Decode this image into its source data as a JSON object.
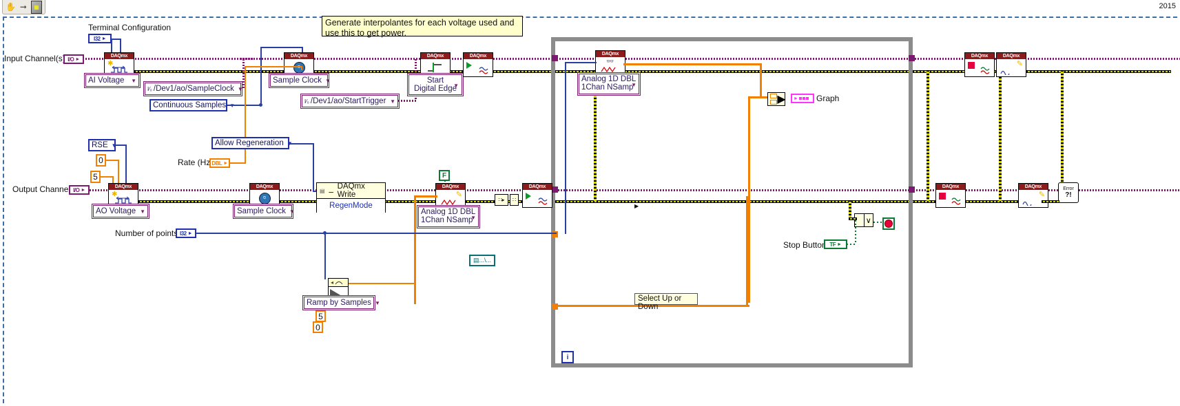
{
  "window": {
    "title_year": "2015",
    "toolbar_icons": [
      "hand-tool-icon",
      "arrow-right-icon",
      "connector-pane-icon"
    ]
  },
  "comments": {
    "interpolantes": "Generate interpolantes for each voltage used and use this to get power.",
    "select_up_down": "Select Up or Down"
  },
  "labels": {
    "terminal_configuration": "Terminal Configuration",
    "input_channels": "Input Channel(s)",
    "output_channel": "Output Channel",
    "rate_hz": "Rate (Hz)",
    "number_of_points": "Number of points",
    "stop_button": "Stop Button",
    "graph": "Graph"
  },
  "terminals": {
    "terminal_config_type": "I32",
    "input_channels_type": "I/O",
    "output_channel_type": "I/O",
    "rate_type": "DBL",
    "number_of_points_type": "I32",
    "stop_button_type": "TF"
  },
  "combos": {
    "ai_voltage": "AI Voltage",
    "ao_voltage": "AO Voltage",
    "sample_clock_ai": "Sample Clock",
    "sample_clock_ao": "Sample Clock",
    "source_sampleclock": "/Dev1/ao/SampleClock",
    "source_starttrigger": "/Dev1/ao/StartTrigger",
    "continuous_samples": "Continuous Samples",
    "allow_regeneration": "Allow Regeneration",
    "start_digital_edge": "Start\nDigital Edge",
    "start_digital_edge_l1": "Start",
    "start_digital_edge_l2": "Digital Edge",
    "rse": "RSE",
    "analog_1d_dbl_read_l1": "Analog 1D DBL",
    "analog_1d_dbl_read_l2": "1Chan NSamp",
    "analog_1d_dbl_write_l1": "Analog 1D DBL",
    "analog_1d_dbl_write_l2": "1Chan NSamp",
    "ramp_by_samples": "Ramp by Samples"
  },
  "vis": {
    "daqmx_write_title": "DAQmx Write",
    "daqmx_write_mode": "RegenMode",
    "error_handler": "Error ?!"
  },
  "constants": {
    "rse_min": "0",
    "rse_max": "5",
    "ramp_start": "5",
    "ramp_end": "0",
    "loop_index": "i",
    "false_const": "F"
  },
  "nodes": {
    "daqmx_create_ai": "DAQmx",
    "daqmx_timing_ai": "DAQmx",
    "daqmx_trigger": "DAQmx",
    "daqmx_start_ai": "DAQmx",
    "daqmx_read": "DAQmx",
    "daqmx_stop_ai": "DAQmx",
    "daqmx_clear_ai": "DAQmx",
    "daqmx_create_ao": "DAQmx",
    "daqmx_timing_ao": "DAQmx",
    "daqmx_write_icon": "DAQmx",
    "daqmx_start_ao": "DAQmx",
    "daqmx_stop_ao": "DAQmx",
    "daqmx_clear_ao": "DAQmx"
  },
  "colors": {
    "daqmx_banner": "#8e1b1b",
    "error_wire": "#d8d400",
    "task_wire": "#7b1a6f",
    "dbl_wire": "#f28000",
    "i32_wire": "#2b3f9e",
    "bool_wire": "#0a7a33",
    "loop_border": "#8c8c8c",
    "comment_bg": "#ffffcc"
  }
}
